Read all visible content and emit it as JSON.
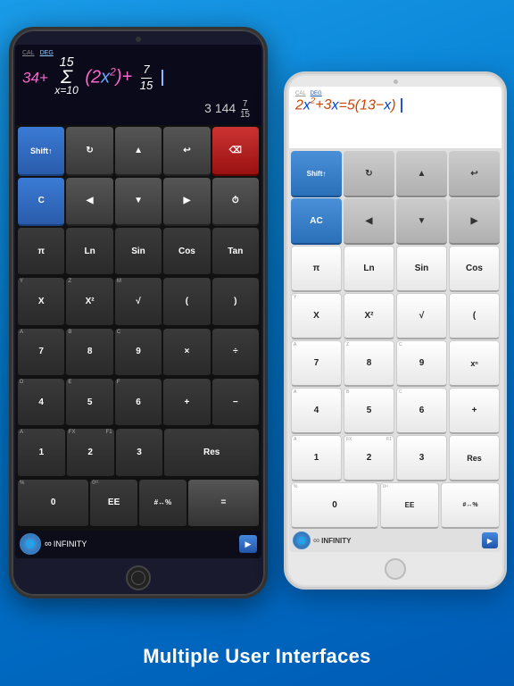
{
  "subtitle": "Multiple User Interfaces",
  "dark_tablet": {
    "mode_labels": [
      "CAL",
      "DEG"
    ],
    "expression": "34+ Σ(2x²)+ 7/15",
    "result": "3 144 7/15",
    "rows": [
      [
        {
          "label": "Shift↑",
          "sub": "",
          "type": "blue",
          "class": "key-shift"
        },
        {
          "label": "↻",
          "sub": "",
          "type": "gray"
        },
        {
          "label": "▲",
          "sub": "",
          "type": "gray"
        },
        {
          "label": "↩",
          "sub": "",
          "type": "gray"
        },
        {
          "label": "⌫",
          "sub": "",
          "type": "red"
        }
      ],
      [
        {
          "label": "C",
          "sub": "",
          "type": "blue"
        },
        {
          "label": "◀",
          "sub": "",
          "type": "gray"
        },
        {
          "label": "▼",
          "sub": "",
          "type": "gray"
        },
        {
          "label": "▶",
          "sub": "",
          "type": "gray"
        },
        {
          "label": "🕐",
          "sub": "",
          "type": "gray"
        }
      ],
      [
        {
          "label": "π",
          "sub": "",
          "type": "dark"
        },
        {
          "label": "Ln",
          "sub": "",
          "type": "dark"
        },
        {
          "label": "Sin",
          "sub": "",
          "type": "dark"
        },
        {
          "label": "Cos",
          "sub": "",
          "type": "dark"
        },
        {
          "label": "Tan",
          "sub": "",
          "type": "dark"
        }
      ],
      [
        {
          "label": "X",
          "sub": "Y",
          "type": "dark"
        },
        {
          "label": "X²",
          "sub": "Z",
          "type": "dark"
        },
        {
          "label": "√",
          "sub": "M",
          "type": "dark"
        },
        {
          "label": "(",
          "sub": "",
          "type": "dark"
        },
        {
          "label": ")",
          "sub": "",
          "type": "dark"
        }
      ],
      [
        {
          "label": "7",
          "sub": "A",
          "sub2": "",
          "type": "dark"
        },
        {
          "label": "8",
          "sub": "B",
          "type": "dark"
        },
        {
          "label": "9",
          "sub": "C",
          "type": "dark"
        },
        {
          "label": "×",
          "sub": "",
          "type": "dark"
        },
        {
          "label": "÷",
          "sub": "",
          "type": "dark"
        }
      ],
      [
        {
          "label": "4",
          "sub": "D",
          "type": "dark"
        },
        {
          "label": "5",
          "sub": "E",
          "type": "dark"
        },
        {
          "label": "6",
          "sub": "F",
          "type": "dark"
        },
        {
          "label": "+",
          "sub": "",
          "type": "dark"
        },
        {
          "label": "−",
          "sub": "",
          "type": "dark"
        }
      ],
      [
        {
          "label": "1",
          "sub": "A",
          "type": "dark"
        },
        {
          "label": "2",
          "sub": "FX",
          "sub2": "F1",
          "type": "dark"
        },
        {
          "label": "3",
          "sub": "",
          "type": "dark"
        },
        {
          "label": "Res",
          "sub": "",
          "type": "dark"
        }
      ],
      [
        {
          "label": "0",
          "sub": "",
          "type": "dark"
        },
        {
          "label": "EE",
          "sub": "0¹¹",
          "type": "dark"
        },
        {
          "label": "#↔%",
          "sub": "",
          "type": "dark"
        },
        {
          "label": "=",
          "sub": "",
          "type": "equal"
        }
      ]
    ],
    "infinity": "∞INFINITY"
  },
  "white_tablet": {
    "mode_labels": [
      "CAL",
      "DEG"
    ],
    "expression": "2x²+3x=5(13−x)",
    "rows": [
      [
        {
          "label": "Shift↑",
          "type": "blue",
          "class": "key-shift"
        },
        {
          "label": "↻",
          "type": "gray"
        },
        {
          "label": "▲",
          "type": "gray"
        },
        {
          "label": "↩",
          "type": "gray"
        }
      ],
      [
        {
          "label": "AC",
          "type": "blue"
        },
        {
          "label": "◀",
          "type": "gray"
        },
        {
          "label": "▼",
          "type": "gray"
        },
        {
          "label": "▶",
          "type": "gray"
        }
      ],
      [
        {
          "label": "π",
          "type": "w"
        },
        {
          "label": "Ln",
          "type": "w"
        },
        {
          "label": "Sin",
          "type": "w"
        },
        {
          "label": "Cos",
          "type": "w"
        }
      ],
      [
        {
          "label": "X",
          "sub": "Y",
          "type": "w"
        },
        {
          "label": "X²",
          "type": "w"
        },
        {
          "label": "√",
          "type": "w"
        },
        {
          "label": "(",
          "type": "w"
        }
      ],
      [
        {
          "label": "7",
          "type": "w"
        },
        {
          "label": "8",
          "type": "w"
        },
        {
          "label": "9",
          "type": "w"
        },
        {
          "label": "x^n",
          "type": "w"
        }
      ],
      [
        {
          "label": "4",
          "type": "w"
        },
        {
          "label": "5",
          "type": "w"
        },
        {
          "label": "6",
          "type": "w"
        },
        {
          "label": "+",
          "type": "w"
        }
      ],
      [
        {
          "label": "1",
          "type": "w"
        },
        {
          "label": "2",
          "type": "w"
        },
        {
          "label": "3",
          "type": "w"
        },
        {
          "label": "Res",
          "type": "w"
        }
      ],
      [
        {
          "label": "0",
          "type": "w"
        },
        {
          "label": "EE",
          "type": "w"
        },
        {
          "label": "#↔%",
          "type": "w"
        }
      ]
    ],
    "infinity": "∞INFINITY"
  }
}
